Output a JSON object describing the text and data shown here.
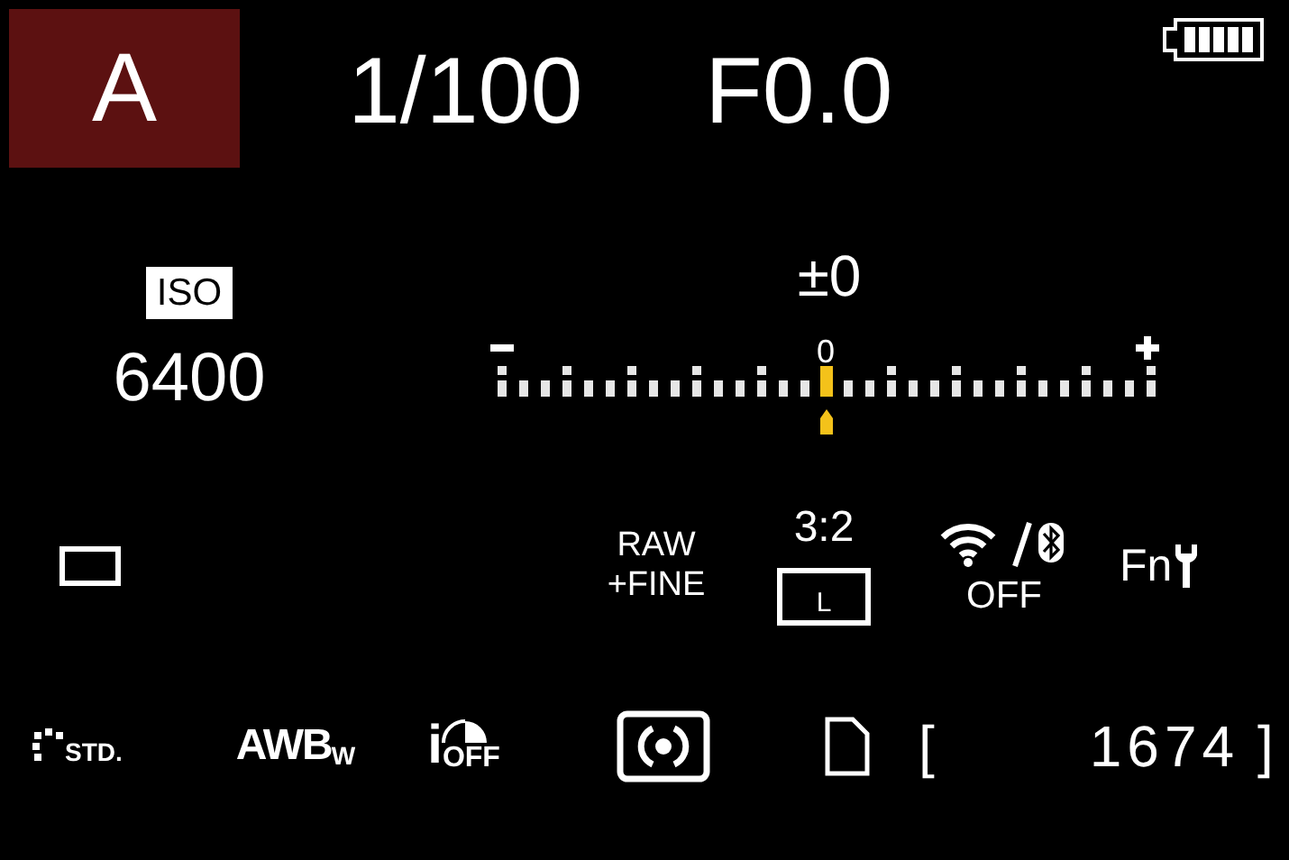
{
  "mode": "A",
  "shutter_speed": "1/100",
  "aperture": "F0.0",
  "iso": {
    "label": "ISO",
    "value": "6400"
  },
  "exposure": {
    "reading": "±0",
    "zero_label": "0",
    "level": 0.5
  },
  "quality": {
    "line_1": "RAW",
    "line_2": "+FINE"
  },
  "aspect_ratio": "3:2",
  "image_size": "L",
  "wireless": {
    "status": "OFF"
  },
  "fn_label": "Fn",
  "photo_style": "STD.",
  "white_balance": {
    "label": "AWB",
    "suffix": "W"
  },
  "i_dynamic": {
    "letter": "i",
    "status": "OFF"
  },
  "card": {
    "bracket_open": "[",
    "shots_remaining": "1674",
    "bracket_close": "]"
  }
}
